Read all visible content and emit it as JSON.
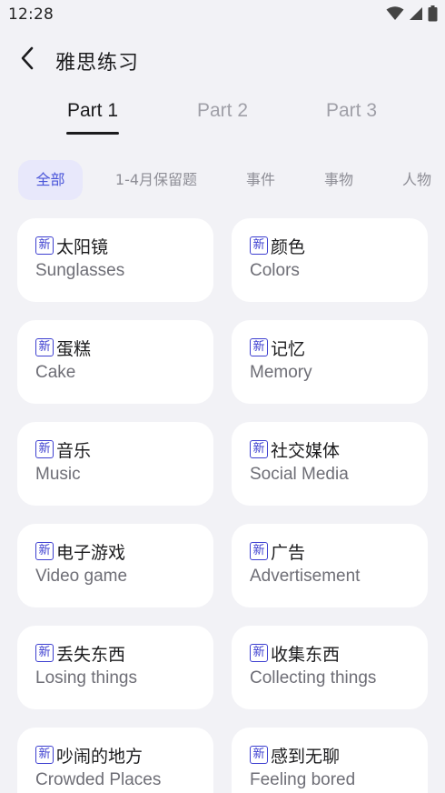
{
  "status_bar": {
    "time": "12:28",
    "icons": [
      "wifi-icon",
      "signal-icon",
      "battery-icon"
    ]
  },
  "header": {
    "title": "雅思练习",
    "back_icon": "chevron-left-icon"
  },
  "part_tabs": [
    {
      "label": "Part 1",
      "active": true
    },
    {
      "label": "Part 2",
      "active": false
    },
    {
      "label": "Part 3",
      "active": false
    }
  ],
  "categories": [
    {
      "label": "全部",
      "active": true
    },
    {
      "label": "1-4月保留题",
      "active": false
    },
    {
      "label": "事件",
      "active": false
    },
    {
      "label": "事物",
      "active": false
    },
    {
      "label": "人物",
      "active": false
    }
  ],
  "badge_label": "新",
  "topics": [
    {
      "zh": "太阳镜",
      "en": "Sunglasses"
    },
    {
      "zh": "颜色",
      "en": "Colors"
    },
    {
      "zh": "蛋糕",
      "en": "Cake"
    },
    {
      "zh": "记忆",
      "en": "Memory"
    },
    {
      "zh": "音乐",
      "en": "Music"
    },
    {
      "zh": "社交媒体",
      "en": "Social Media"
    },
    {
      "zh": "电子游戏",
      "en": "Video game"
    },
    {
      "zh": "广告",
      "en": "Advertisement"
    },
    {
      "zh": "丢失东西",
      "en": "Losing things"
    },
    {
      "zh": "收集东西",
      "en": "Collecting things"
    },
    {
      "zh": "吵闹的地方",
      "en": "Crowded Places"
    },
    {
      "zh": "感到无聊",
      "en": "Feeling bored"
    }
  ],
  "colors": {
    "background": "#f2f2f6",
    "accent": "#4a55d9",
    "chip_active_bg": "#e8e8fb",
    "badge": "#3d3fd0"
  }
}
